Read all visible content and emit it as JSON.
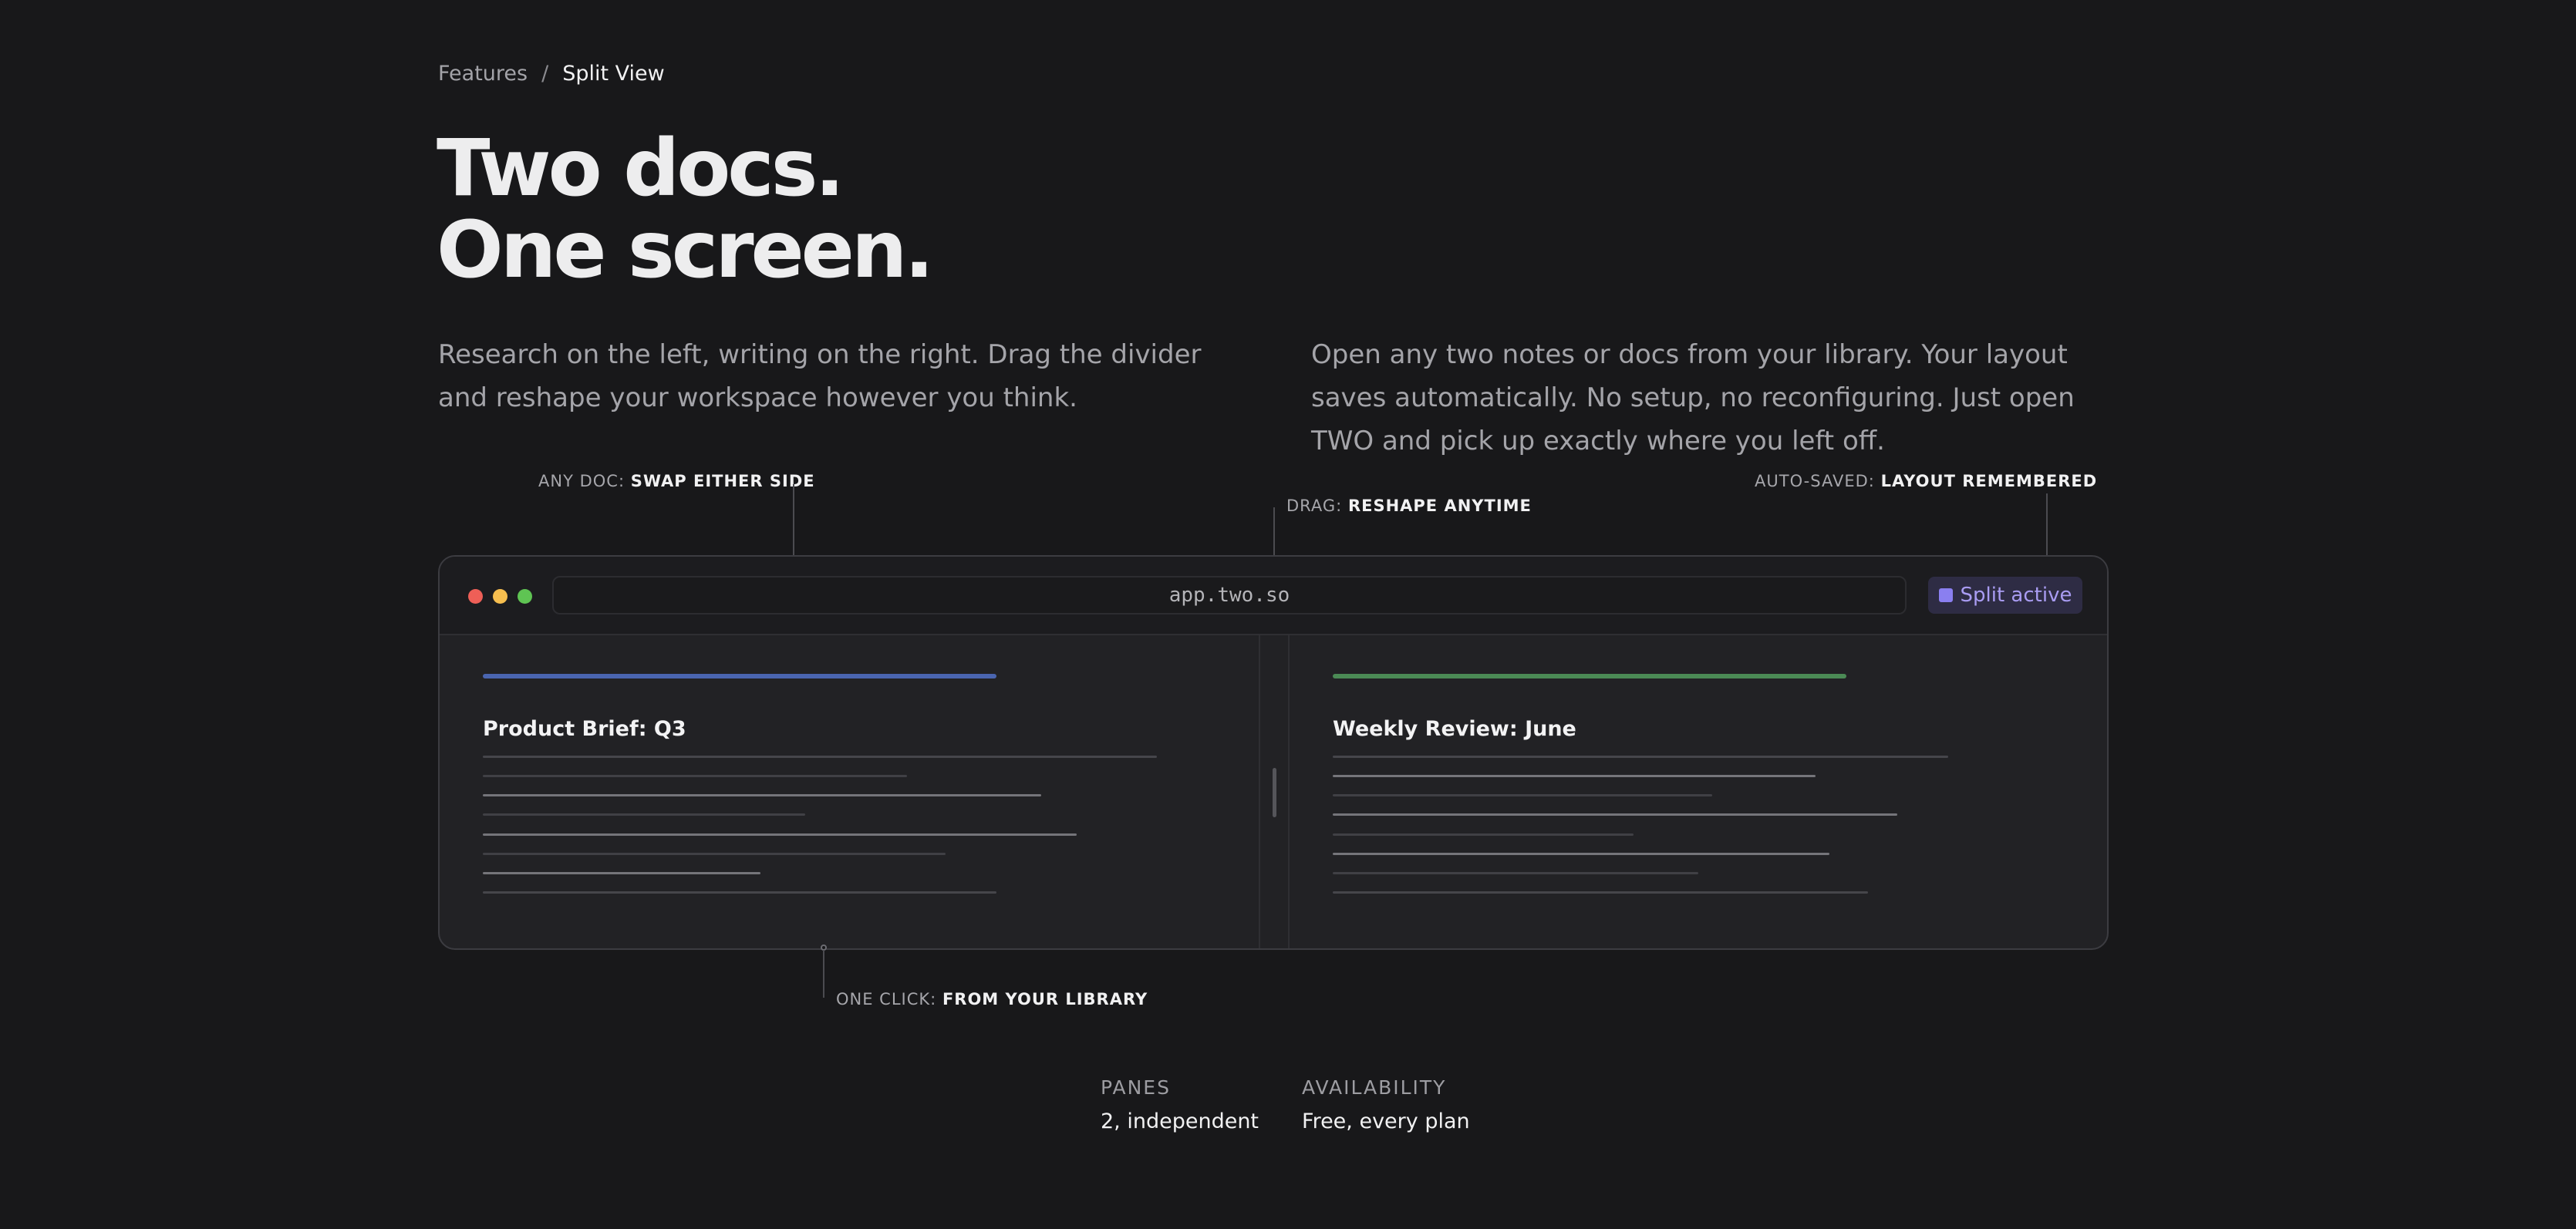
{
  "breadcrumb": {
    "parent": "Features",
    "separator": "/",
    "current": "Split View"
  },
  "hero": {
    "line1": "Two docs.",
    "line2": "One screen."
  },
  "descriptions": {
    "left": "Research on the left, writing on the right. Drag the divider and reshape your workspace however you think.",
    "right": "Open any two notes or docs from your library. Your layout saves automatically. No setup, no reconfiguring. Just open TWO and pick up exactly where you left off."
  },
  "callouts": [
    {
      "label": "ANY DOC:",
      "value": "SWAP EITHER SIDE"
    },
    {
      "label": "DRAG:",
      "value": "RESHAPE ANYTIME"
    },
    {
      "label": "AUTO-SAVED:",
      "value": "LAYOUT REMEMBERED"
    },
    {
      "label": "ONE CLICK:",
      "value": "FROM YOUR LIBRARY"
    }
  ],
  "window": {
    "url": "app.two.so",
    "badge": "Split active",
    "left_doc": {
      "title": "Product Brief: Q3",
      "accent_color": "#4a65b0"
    },
    "right_doc": {
      "title": "Weekly Review: June",
      "accent_color": "#4b8a55"
    }
  },
  "stats": [
    {
      "label": "PANES",
      "value": "2, independent"
    },
    {
      "label": "AVAILABILITY",
      "value": "Free, every plan"
    }
  ],
  "colors": {
    "background": "#18181a",
    "window": "#222225",
    "badge_bg": "#2e2c44",
    "badge_text": "#a99cf2",
    "traffic_red": "#ee5f57",
    "traffic_yellow": "#f6be4f",
    "traffic_green": "#5fc453"
  }
}
